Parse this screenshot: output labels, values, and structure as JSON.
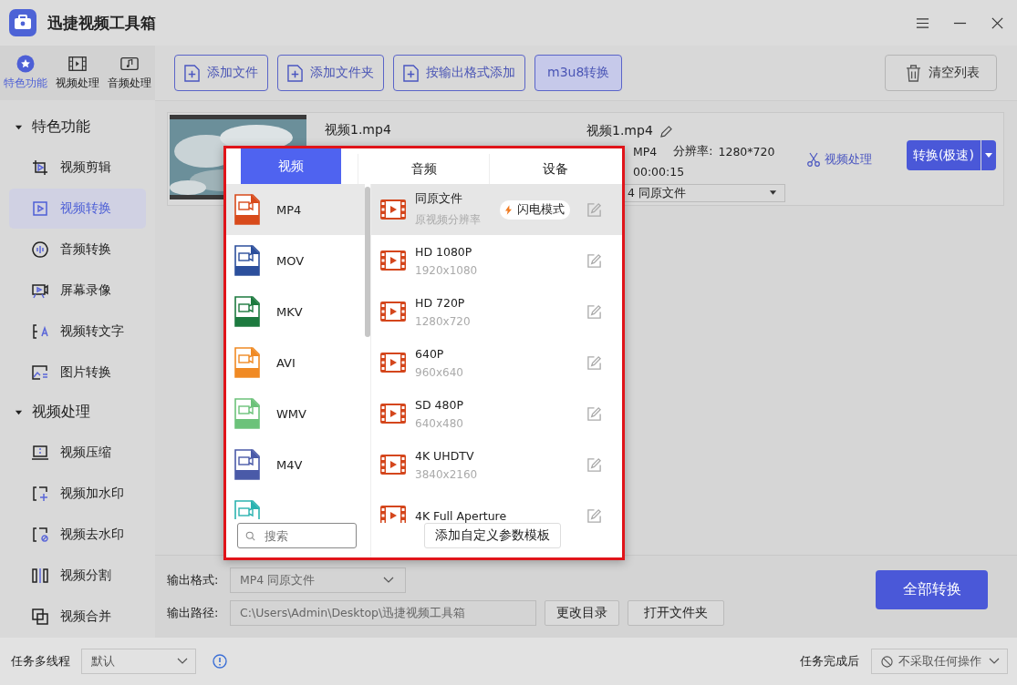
{
  "window": {
    "title": "迅捷视频工具箱"
  },
  "sidebar": {
    "tabs": [
      {
        "label": "特色功能",
        "selected": true
      },
      {
        "label": "视频处理",
        "selected": false
      },
      {
        "label": "音频处理",
        "selected": false
      }
    ],
    "groups": [
      {
        "label": "特色功能",
        "expanded": true,
        "items": [
          {
            "label": "视频剪辑",
            "selected": false
          },
          {
            "label": "视频转换",
            "selected": true
          },
          {
            "label": "音频转换",
            "selected": false
          },
          {
            "label": "屏幕录像",
            "selected": false
          },
          {
            "label": "视频转文字",
            "selected": false
          },
          {
            "label": "图片转换",
            "selected": false
          }
        ]
      },
      {
        "label": "视频处理",
        "expanded": true,
        "items": [
          {
            "label": "视频压缩",
            "selected": false
          },
          {
            "label": "视频加水印",
            "selected": false
          },
          {
            "label": "视频去水印",
            "selected": false
          },
          {
            "label": "视频分割",
            "selected": false
          },
          {
            "label": "视频合并",
            "selected": false
          }
        ]
      }
    ]
  },
  "toolbar": {
    "buttons": [
      {
        "label": "添加文件",
        "kind": "add"
      },
      {
        "label": "添加文件夹",
        "kind": "add"
      },
      {
        "label": "按输出格式添加",
        "kind": "add"
      },
      {
        "label": "m3u8转换",
        "kind": "plain"
      }
    ],
    "clear_button": "清空列表"
  },
  "file": {
    "source_name": "视频1.mp4",
    "output_name": "视频1.mp4",
    "format": "MP4",
    "resolution_label": "分辨率:",
    "resolution": "1280*720",
    "duration": "00:00:15",
    "output_preset": "4  同原文件",
    "process_link": "视频处理",
    "convert_button": "转换(极速)"
  },
  "format_popup": {
    "tabs": [
      {
        "label": "视频",
        "selected": true
      },
      {
        "label": "音频",
        "selected": false
      },
      {
        "label": "设备",
        "selected": false
      }
    ],
    "formats": [
      {
        "name": "MP4",
        "color": "#d84a1b",
        "selected": true
      },
      {
        "name": "MOV",
        "color": "#2c4f9c",
        "selected": false
      },
      {
        "name": "MKV",
        "color": "#1d7a3f",
        "selected": false
      },
      {
        "name": "AVI",
        "color": "#f08a24",
        "selected": false
      },
      {
        "name": "WMV",
        "color": "#6cc27a",
        "selected": false
      },
      {
        "name": "M4V",
        "color": "#4a5aa8",
        "selected": false
      },
      {
        "color": "#2bb3b0",
        "selected": false
      }
    ],
    "presets": [
      {
        "title": "同原文件",
        "subtitle": "原视频分辨率",
        "badge": "闪电模式",
        "selected": true
      },
      {
        "title": "HD 1080P",
        "subtitle": "1920x1080",
        "selected": false
      },
      {
        "title": "HD 720P",
        "subtitle": "1280x720",
        "selected": false
      },
      {
        "title": "640P",
        "subtitle": "960x640",
        "selected": false
      },
      {
        "title": "SD 480P",
        "subtitle": "640x480",
        "selected": false
      },
      {
        "title": "4K UHDTV",
        "subtitle": "3840x2160",
        "selected": false
      },
      {
        "title": "4K Full Aperture",
        "selected": false
      }
    ],
    "search": {
      "placeholder": "搜索"
    },
    "add_template_button": "添加自定义参数模板"
  },
  "output": {
    "format_label": "输出格式:",
    "format_value": "MP4  同原文件",
    "path_label": "输出路径:",
    "path_value": "C:\\Users\\Admin\\Desktop\\迅捷视频工具箱",
    "change_dir_button": "更改目录",
    "open_folder_button": "打开文件夹",
    "convert_all_button": "全部转换"
  },
  "status_bar": {
    "threads_label": "任务多线程",
    "threads_value": "默认",
    "after_label": "任务完成后",
    "after_value": "不采取任何操作"
  }
}
